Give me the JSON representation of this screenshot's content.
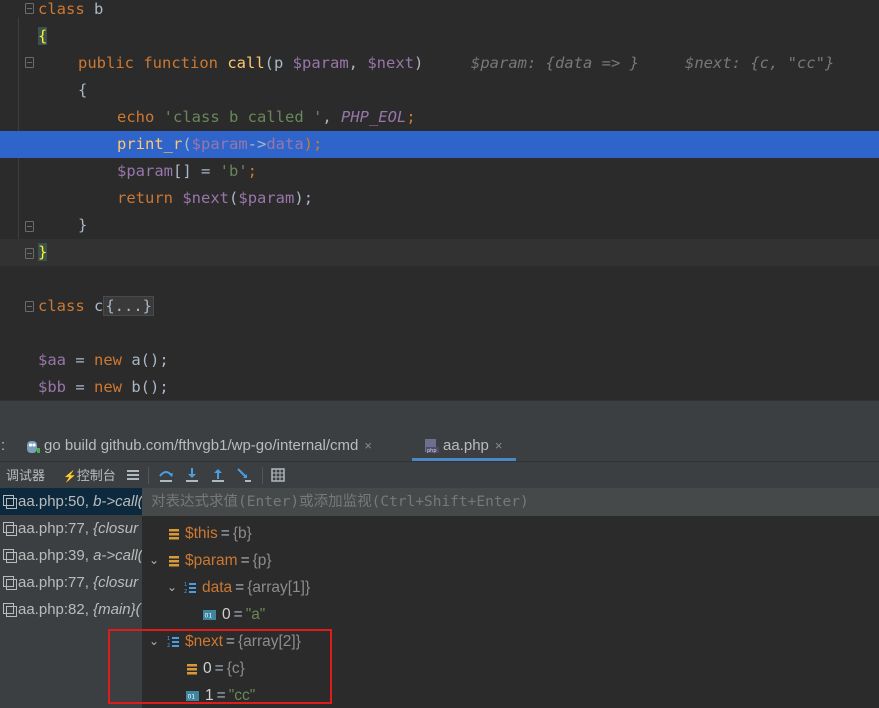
{
  "editor": {
    "lines": {
      "l1": {
        "kw": "class",
        "name": " b"
      },
      "l2": {
        "brace": "{"
      },
      "l3": {
        "kw": "public function",
        "fn": "call",
        "open": "(p ",
        "p1": "$param",
        "comma": ", ",
        "p2": "$next",
        "close": ")",
        "hint1": "$param: {data => }",
        "hint2": "$next: {c, \"cc\"}"
      },
      "l4": {
        "text": "{"
      },
      "l5": {
        "kw": "echo",
        "str": "'class b called '",
        "comma": ", ",
        "const": "PHP_EOL",
        "semi": ";"
      },
      "l6": {
        "fn": "print_r",
        "open": "(",
        "var": "$param",
        "arrow": "->",
        "prop": "data",
        "close": ");"
      },
      "l7": {
        "var": "$param",
        "rest": "[] = ",
        "str": "'b'",
        "semi": ";"
      },
      "l8": {
        "kw": "return",
        "var": "$next",
        "open": "(",
        "arg": "$param",
        "close": ");"
      },
      "l9": {
        "text": "}"
      },
      "l10": {
        "brace": "}"
      },
      "l11": {
        "kw": "class",
        "name": " c",
        "collapsed": "{...}"
      },
      "l12": {
        "var": "$aa",
        "eq": " = ",
        "kw": "new",
        "call": " a();"
      },
      "l13": {
        "var": "$bb",
        "eq": " = ",
        "kw": "new",
        "call": " b();"
      }
    }
  },
  "tabs": {
    "colon": ":",
    "tab1": "go build github.com/fthvgb1/wp-go/internal/cmd",
    "tab2": "aa.php",
    "close": "×"
  },
  "toolbar": {
    "debugger": "调试器",
    "console": "控制台"
  },
  "frames": [
    {
      "file": "aa.php:50, ",
      "fn": "b->call("
    },
    {
      "file": "aa.php:77, ",
      "fn": "{closur"
    },
    {
      "file": "aa.php:39, ",
      "fn": "a->call("
    },
    {
      "file": "aa.php:77, ",
      "fn": "{closur"
    },
    {
      "file": "aa.php:82, ",
      "fn": "{main}("
    }
  ],
  "variables": {
    "eval_placeholder": "对表达式求值(Enter)或添加监视(Ctrl+Shift+Enter)",
    "this": {
      "name": "$this",
      "value": "{b}"
    },
    "param": {
      "name": "$param",
      "value": "{p}"
    },
    "data": {
      "name": "data",
      "value": "{array[1]}"
    },
    "data0": {
      "name": "0",
      "value": "\"a\""
    },
    "next": {
      "name": "$next",
      "value": "{array[2]}"
    },
    "next0": {
      "name": "0",
      "value": "{c}"
    },
    "next1": {
      "name": "1",
      "value": "\"cc\""
    },
    "eq": "="
  },
  "colors": {
    "breakpoint_line": "#2f65ca",
    "annotation_box": "#e01b1b",
    "keyword": "#cc7832",
    "variable": "#9876aa",
    "string": "#6a8759"
  }
}
